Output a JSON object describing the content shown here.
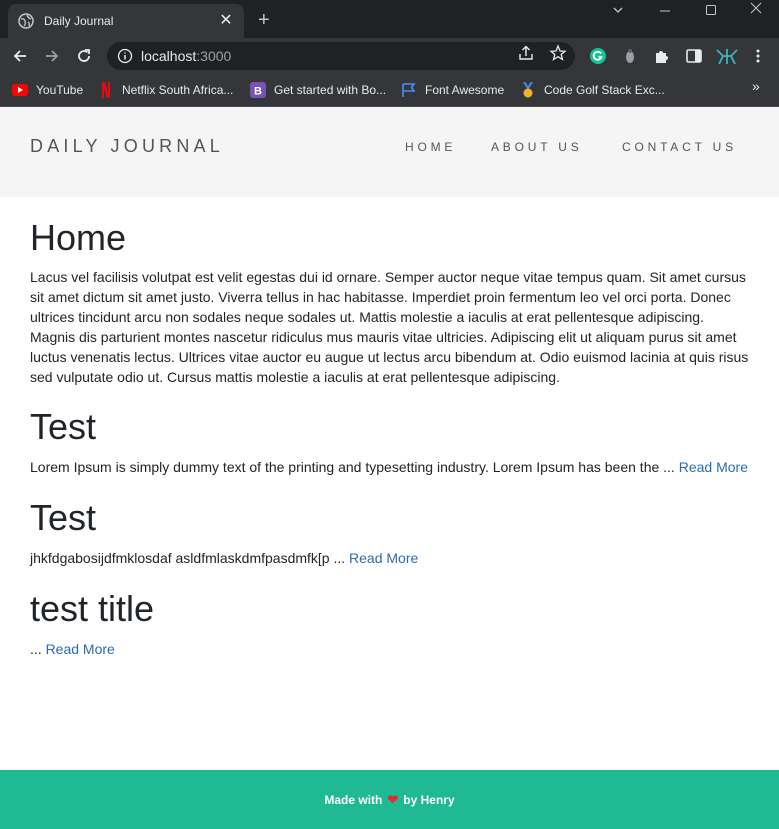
{
  "browser": {
    "tab": {
      "title": "Daily Journal",
      "close": "✕"
    },
    "new_tab": "+",
    "url": {
      "host": "localhost",
      "port": ":3000"
    },
    "bookmarks": [
      {
        "label": "YouTube",
        "icon": "youtube-icon"
      },
      {
        "label": "Netflix South Africa...",
        "icon": "netflix-icon"
      },
      {
        "label": "Get started with Bo...",
        "icon": "bootstrap-icon"
      },
      {
        "label": "Font Awesome",
        "icon": "flag-icon"
      },
      {
        "label": "Code Golf Stack Exc...",
        "icon": "medal-icon"
      }
    ],
    "bookmarks_more": "»"
  },
  "site": {
    "brand": "DAILY JOURNAL",
    "nav": [
      "HOME",
      "ABOUT US",
      "CONTACT US"
    ]
  },
  "home": {
    "title": "Home",
    "body": "Lacus vel facilisis volutpat est velit egestas dui id ornare. Semper auctor neque vitae tempus quam. Sit amet cursus sit amet dictum sit amet justo. Viverra tellus in hac habitasse. Imperdiet proin fermentum leo vel orci porta. Donec ultrices tincidunt arcu non sodales neque sodales ut. Mattis molestie a iaculis at erat pellentesque adipiscing. Magnis dis parturient montes nascetur ridiculus mus mauris vitae ultricies. Adipiscing elit ut aliquam purus sit amet luctus venenatis lectus. Ultrices vitae auctor eu augue ut lectus arcu bibendum at. Odio euismod lacinia at quis risus sed vulputate odio ut. Cursus mattis molestie a iaculis at erat pellentesque adipiscing."
  },
  "posts": [
    {
      "title": "Test",
      "excerpt": "Lorem Ipsum is simply dummy text of the printing and typesetting industry. Lorem Ipsum has been the ...",
      "link": "Read More"
    },
    {
      "title": "Test",
      "excerpt": "jhkfdgabosijdfmklosdaf asldfmlaskdmfpasdmfk[p ...",
      "link": "Read More"
    },
    {
      "title": "test title",
      "excerpt": "...",
      "link": "Read More"
    }
  ],
  "footer": {
    "prefix": "Made with",
    "suffix": "by Henry",
    "heart": "❤"
  },
  "colors": {
    "footer_bg": "#1fb994",
    "link": "#2a6cb3",
    "header_bg": "#f5f5f5"
  }
}
